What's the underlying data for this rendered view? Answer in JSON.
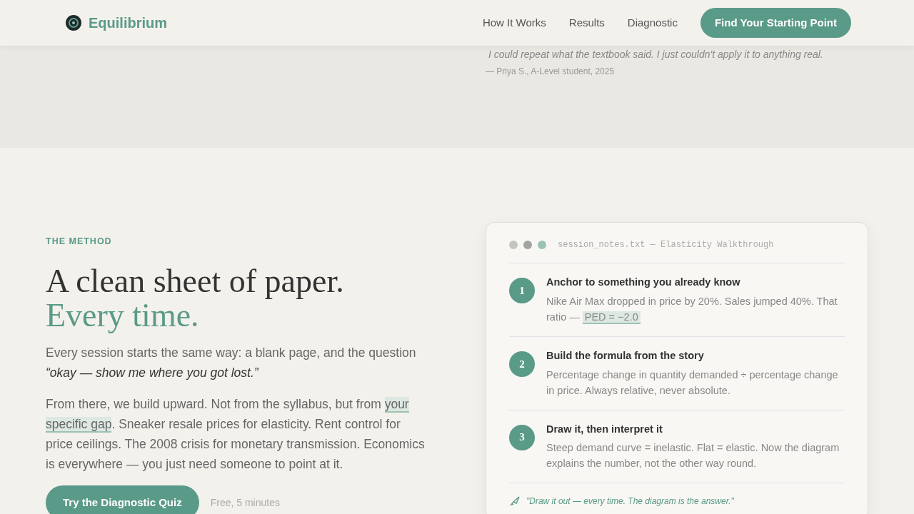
{
  "nav": {
    "brand": "Equilibrium",
    "links": [
      {
        "label": "How It Works"
      },
      {
        "label": "Results"
      },
      {
        "label": "Diagnostic"
      }
    ],
    "cta": "Find Your Starting Point"
  },
  "testimonial": {
    "quote": "I could repeat what the textbook said. I just couldn't apply it to anything real.",
    "attribution": "— Priya S., A-Level student, 2025"
  },
  "method": {
    "eyebrow": "THE METHOD",
    "heading_line_1": "A clean sheet of paper.",
    "heading_line_2": "Every time.",
    "paragraph_1": "Every session starts the same way: a blank page, and the question",
    "paragraph_1_quote": "“okay — show me where you got lost.”",
    "paragraph_2_before": "From there, we build upward. Not from the syllabus, but from",
    "paragraph_2_highlight": "your specific gap",
    "paragraph_2_after": ". Sneaker resale prices for elasticity. Rent control for price ceilings. The 2008 crisis for monetary transmission. Economics is everywhere — you just need someone to point at it.",
    "button": "Try the Diagnostic Quiz",
    "note": "Free, 5 minutes"
  },
  "notes_card": {
    "title": "session_notes.txt — Elasticity Walkthrough",
    "steps": [
      {
        "number": "1",
        "title": "Anchor to something you already know",
        "text": "Nike Air Max dropped in price by 20%. Sales jumped 40%. That ratio —",
        "formula": "PED = −2.0"
      },
      {
        "number": "2",
        "title": "Build the formula from the story",
        "text": "Percentage change in quantity demanded ÷ percentage change in price. Always relative, never absolute."
      },
      {
        "number": "3",
        "title": "Draw it, then interpret it",
        "text": "Steep demand curve = inelastic. Flat = elastic. Now the diagram explains the number, not the other way round."
      }
    ],
    "footer_quote": "\"Draw it out — every time. The diagram is the answer.\""
  }
}
